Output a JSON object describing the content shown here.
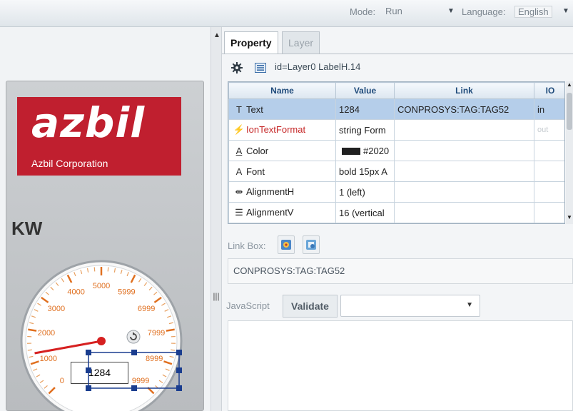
{
  "topbar": {
    "mode_label": "Mode:",
    "mode_value": "Run",
    "language_label": "Language:",
    "language_value": "English"
  },
  "canvas": {
    "brand": "azbil",
    "brand_sub": "Azbil Corporation",
    "unit": "KW",
    "gauge_ticks": [
      "0",
      "1000",
      "2000",
      "3000",
      "4000",
      "5000",
      "5999",
      "6999",
      "7999",
      "8999",
      "9999"
    ],
    "gauge_value": "1284",
    "gauge_value_numeric": 1284,
    "gauge_max": 9999
  },
  "tabs": [
    {
      "label": "Property",
      "active": true
    },
    {
      "label": "Layer",
      "active": false
    }
  ],
  "toolbar": {
    "id_text": "id=Layer0 LabelH.14"
  },
  "property_table": {
    "headers": [
      "Name",
      "Value",
      "Link",
      "IO"
    ],
    "rows": [
      {
        "icon": "T",
        "icon_name": "text-icon",
        "name": "Text",
        "value": "1284",
        "link": "CONPROSYS:TAG:TAG52",
        "io": "in",
        "selected": true
      },
      {
        "icon": "⚡",
        "icon_name": "format-icon",
        "name": "IonTextFormat",
        "value": "string Form",
        "link": "",
        "io": "out",
        "highlight": true
      },
      {
        "icon": "A",
        "icon_name": "color-icon",
        "name": "Color",
        "value": "#2020",
        "link": "",
        "io": "",
        "swatch": "#202020"
      },
      {
        "icon": "A",
        "icon_name": "font-icon",
        "name": "Font",
        "value": "bold 15px A",
        "link": "",
        "io": ""
      },
      {
        "icon": "⇹",
        "icon_name": "align-horizontal-icon",
        "name": "AlignmentH",
        "value": "1 (left)",
        "link": "",
        "io": ""
      },
      {
        "icon": "☰",
        "icon_name": "align-vertical-icon",
        "name": "AlignmentV",
        "value": "16 (vertical",
        "link": "",
        "io": ""
      }
    ]
  },
  "link_box": {
    "label": "Link Box:",
    "value": "CONPROSYS:TAG:TAG52"
  },
  "javascript": {
    "label": "JavaScript",
    "validate_label": "Validate",
    "select_value": ""
  }
}
